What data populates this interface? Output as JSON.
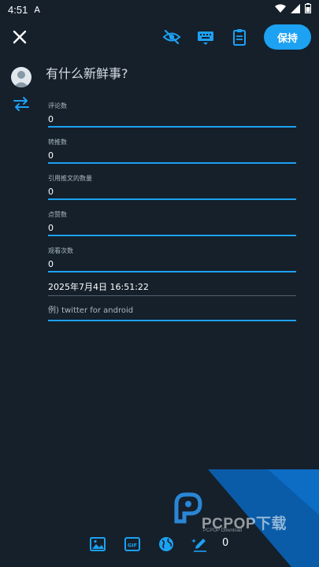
{
  "status_bar": {
    "time": "4:51",
    "notification_glyph": "A"
  },
  "toolbar": {
    "icons": [
      "close-icon",
      "eye-off-icon",
      "keyboard-icon",
      "clipboard-icon"
    ],
    "save_label": "保持"
  },
  "composer": {
    "prompt": "有什么新鲜事?"
  },
  "fields": [
    {
      "label": "评论数",
      "value": "0"
    },
    {
      "label": "转推数",
      "value": "0"
    },
    {
      "label": "引用推文的数量",
      "value": "0"
    },
    {
      "label": "点赞数",
      "value": "0"
    },
    {
      "label": "观看次数",
      "value": "0"
    }
  ],
  "datetime": "2025年7月4日 16:51:22",
  "client_input": {
    "placeholder": "例) twitter for android"
  },
  "watermark": {
    "text": "PCPOP下载",
    "sub": "PCPOP Download"
  },
  "bottom_bar": {
    "icons": [
      "image-icon",
      "gif-icon",
      "globe-icon",
      "edit-icon"
    ],
    "count": "0"
  },
  "colors": {
    "background": "#15202b",
    "accent": "#1da1f2"
  }
}
